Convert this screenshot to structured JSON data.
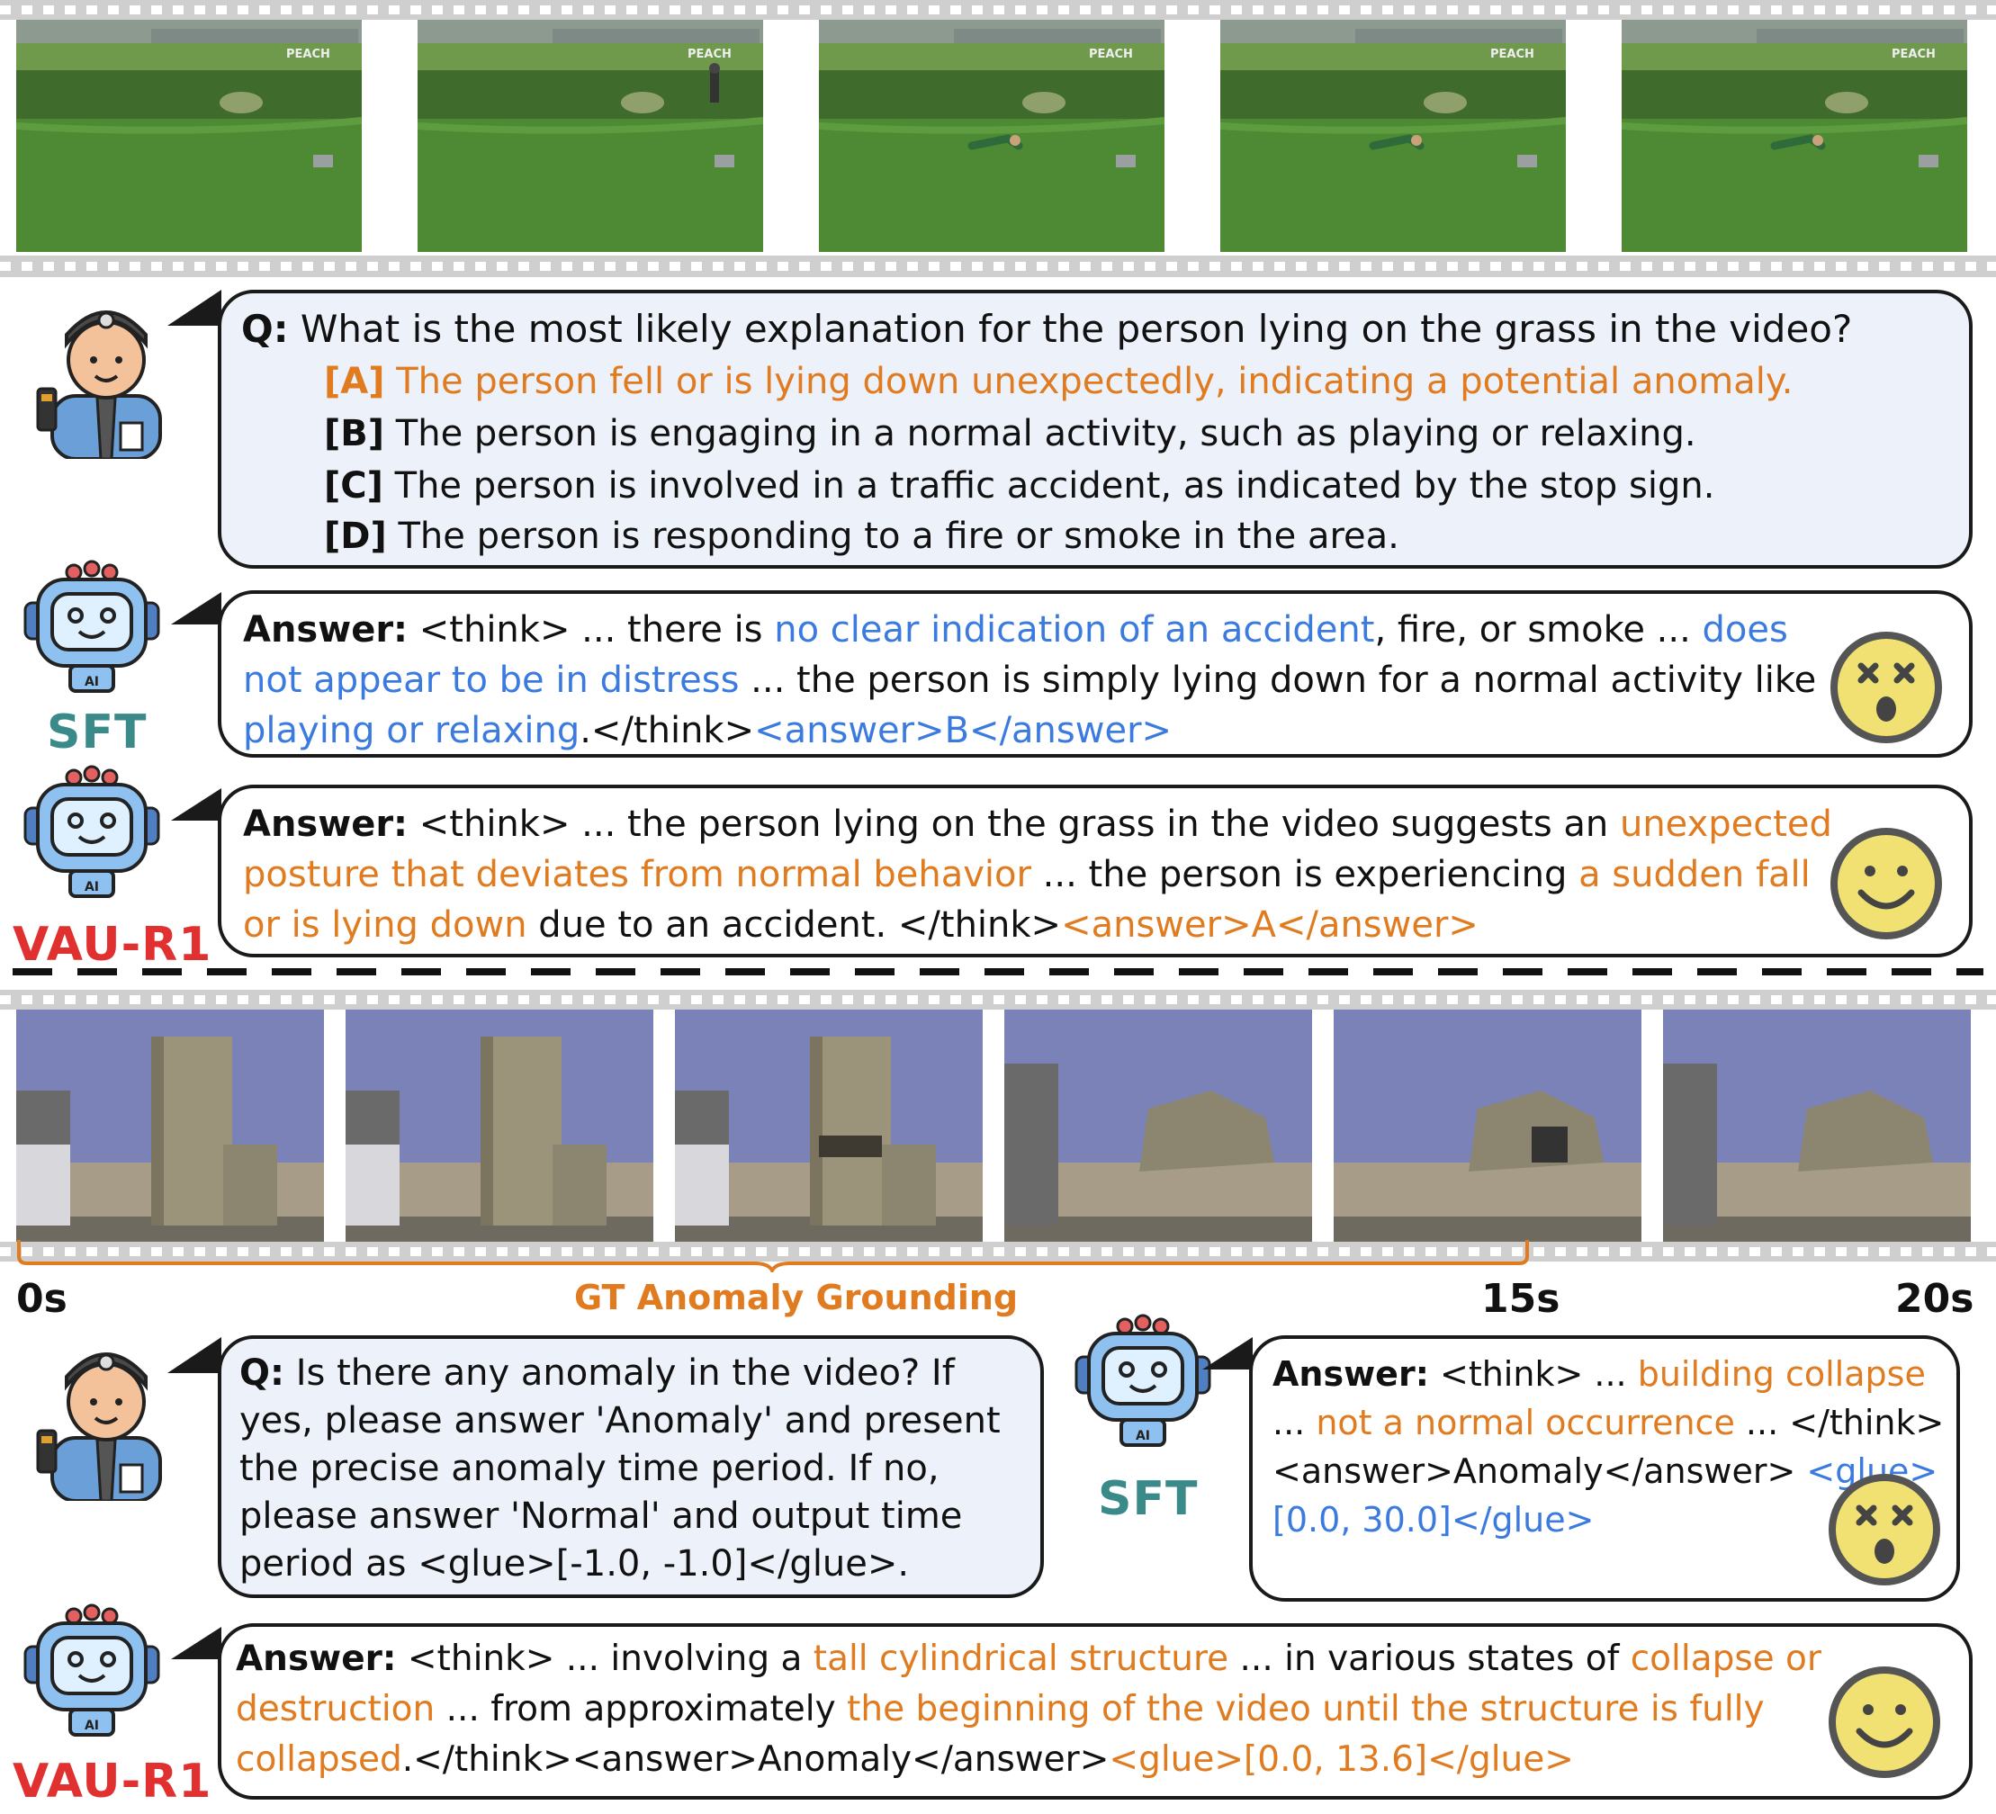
{
  "example1": {
    "question_prefix": "Q:",
    "question": "What is the most likely explanation for the person lying on the grass in the video?",
    "options": [
      {
        "key": "[A]",
        "text": "The person fell or is lying down unexpectedly, indicating a potential anomaly."
      },
      {
        "key": "[B]",
        "text": "The person is engaging in a normal activity, such as playing or relaxing."
      },
      {
        "key": "[C]",
        "text": "The person is involved in a traffic accident, as indicated by the stop sign."
      },
      {
        "key": "[D]",
        "text": "The person is responding to a fire or smoke in the area."
      }
    ],
    "frame_watermark": "PEACH",
    "sft": {
      "label": "SFT",
      "answer_prefix": "Answer:",
      "t1": " <think> ... there is ",
      "h1": "no clear indication of an accident",
      "t2": ", fire, or smoke ... ",
      "h2": "does not appear to be in distress",
      "t3": " ... the person is simply lying down for a normal activity like ",
      "h3": "playing or relaxing",
      "t4": ".</think>",
      "h4": "<answer>B</answer>"
    },
    "vau": {
      "label": "VAU-R1",
      "answer_prefix": "Answer:",
      "t1": " <think> ... the person lying on the grass in the video suggests an ",
      "h1": "unexpected posture that deviates from normal behavior",
      "t2": " ... the person is experiencing ",
      "h2": "a sudden fall or is lying down",
      "t3": " due to an accident. </think>",
      "h3": "<answer>A</answer>"
    }
  },
  "example2": {
    "timeline": {
      "start": "0s",
      "grounding_label": "GT Anomaly Grounding",
      "gt_end": "15s",
      "end": "20s"
    },
    "question_prefix": "Q:",
    "question": " Is there any anomaly in the video? If yes, please answer 'Anomaly' and present the precise anomaly time period. If no, please answer 'Normal' and output time period as <glue>[-1.0, -1.0]</glue>.",
    "sft": {
      "label": "SFT",
      "answer_prefix": "Answer:",
      "t1": " <think> ... ",
      "h1": "building collapse",
      "t2": " ... ",
      "h2": "not a normal occurrence",
      "t3": " ... </think> <answer>Anomaly</answer> ",
      "h3": "<glue>[0.0, 30.0]</glue>"
    },
    "vau": {
      "label": "VAU-R1",
      "answer_prefix": "Answer:",
      "t1": " <think> ... involving a ",
      "h1": "tall cylindrical structure",
      "t2": " ... in various states of ",
      "h2": "collapse or destruction",
      "t3": " ... from approximately ",
      "h3": "the beginning of the video until the structure is fully collapsed",
      "t4": ".</think><answer>Anomaly</answer>",
      "h4": "<glue>[0.0, 13.6]</glue>"
    }
  },
  "colors": {
    "orange": "#e07b20",
    "blue": "#3b7be0",
    "teal": "#3a8a8a",
    "red": "#e03030",
    "bubble_bg": "#edf1fa"
  },
  "icons": [
    "security-guard-icon",
    "robot-ai-icon",
    "dizzy-face-icon",
    "smiley-face-icon"
  ]
}
